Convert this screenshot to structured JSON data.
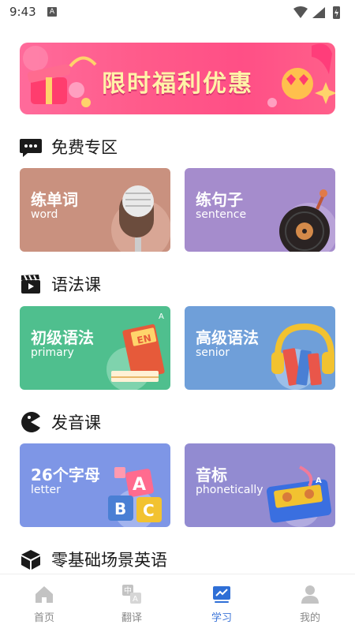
{
  "status_bar": {
    "time": "9:43",
    "notification_icon": "A"
  },
  "banner": {
    "text": "限时福利优惠"
  },
  "sections": [
    {
      "title": "免费专区",
      "icon": "chat-icon"
    },
    {
      "title": "语法课",
      "icon": "clapper-icon"
    },
    {
      "title": "发音课",
      "icon": "pacman-icon"
    },
    {
      "title": "零基础场景英语",
      "icon": "box-icon"
    }
  ],
  "cards": {
    "word": {
      "title": "练单词",
      "sub": "word",
      "color": "#c9917f"
    },
    "sentence": {
      "title": "练句子",
      "sub": "sentence",
      "color": "#a58ccc"
    },
    "primary": {
      "title": "初级语法",
      "sub": "primary",
      "color": "#4fbf8e"
    },
    "senior": {
      "title": "高级语法",
      "sub": "senior",
      "color": "#6f9fd9"
    },
    "letter": {
      "title": "26个字母",
      "sub": "letter",
      "color": "#7e96e6"
    },
    "phonetic": {
      "title": "音标",
      "sub": "phonetically",
      "color": "#928bd1"
    }
  },
  "tabs": [
    {
      "label": "首页",
      "icon": "home-icon"
    },
    {
      "label": "翻译",
      "icon": "translate-icon"
    },
    {
      "label": "学习",
      "icon": "study-chart-icon",
      "active": true
    },
    {
      "label": "我的",
      "icon": "profile-icon"
    }
  ]
}
